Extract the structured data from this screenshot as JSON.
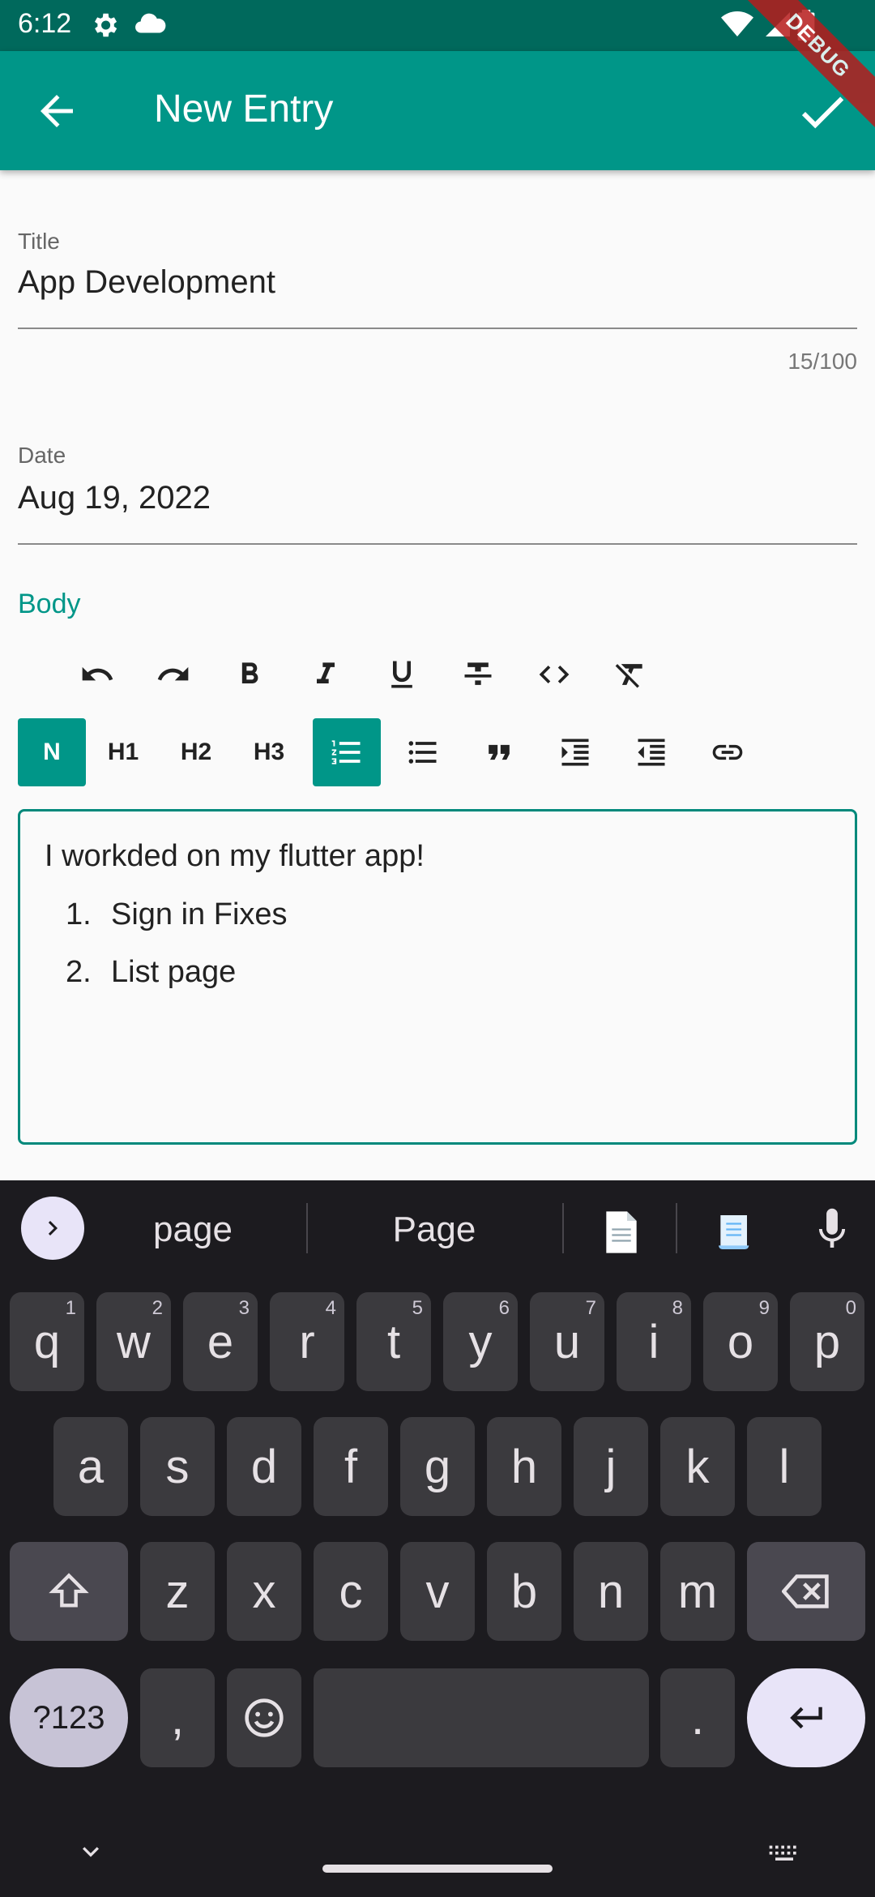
{
  "status_bar": {
    "time": "6:12",
    "debug_label": "DEBUG"
  },
  "app_bar": {
    "title": "New Entry"
  },
  "form": {
    "title_label": "Title",
    "title_value": "App Development",
    "title_counter": "15/100",
    "date_label": "Date",
    "date_value": "Aug 19, 2022",
    "body_label": "Body"
  },
  "toolbar": {
    "row2_text_buttons": {
      "normal": "N",
      "h1": "H1",
      "h2": "H2",
      "h3": "H3"
    }
  },
  "editor": {
    "intro": "I workded on my flutter app!",
    "list_items": [
      {
        "num": "1.",
        "text": "Sign in Fixes"
      },
      {
        "num": "2.",
        "text": "List page"
      }
    ]
  },
  "keyboard": {
    "suggestions": [
      "page",
      "Page"
    ],
    "row1": [
      {
        "key": "q",
        "sup": "1"
      },
      {
        "key": "w",
        "sup": "2"
      },
      {
        "key": "e",
        "sup": "3"
      },
      {
        "key": "r",
        "sup": "4"
      },
      {
        "key": "t",
        "sup": "5"
      },
      {
        "key": "y",
        "sup": "6"
      },
      {
        "key": "u",
        "sup": "7"
      },
      {
        "key": "i",
        "sup": "8"
      },
      {
        "key": "o",
        "sup": "9"
      },
      {
        "key": "p",
        "sup": "0"
      }
    ],
    "row2": [
      "a",
      "s",
      "d",
      "f",
      "g",
      "h",
      "j",
      "k",
      "l"
    ],
    "row3": [
      "z",
      "x",
      "c",
      "v",
      "b",
      "n",
      "m"
    ],
    "symbols_label": "?123",
    "comma": ",",
    "period": "."
  },
  "colors": {
    "primary": "#009688",
    "status_bar": "#00695c",
    "keyboard_bg": "#1c1b1f"
  }
}
